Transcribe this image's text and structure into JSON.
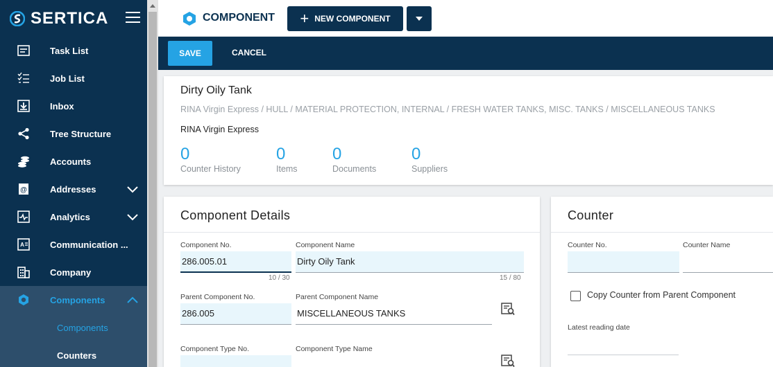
{
  "brand": {
    "name": "SERTICA"
  },
  "sidebar": {
    "items": [
      {
        "label": "Task List",
        "icon": "task-list-icon"
      },
      {
        "label": "Job List",
        "icon": "job-list-icon"
      },
      {
        "label": "Inbox",
        "icon": "inbox-icon"
      },
      {
        "label": "Tree Structure",
        "icon": "tree-structure-icon"
      },
      {
        "label": "Accounts",
        "icon": "accounts-icon"
      },
      {
        "label": "Addresses",
        "icon": "addresses-icon"
      },
      {
        "label": "Analytics",
        "icon": "analytics-icon"
      },
      {
        "label": "Communication ...",
        "icon": "communication-icon"
      },
      {
        "label": "Company",
        "icon": "company-icon"
      },
      {
        "label": "Components",
        "icon": "components-icon"
      }
    ],
    "sub_items": [
      {
        "label": "Components"
      },
      {
        "label": "Counters"
      }
    ]
  },
  "topbar": {
    "title": "COMPONENT",
    "new_button": "NEW COMPONENT"
  },
  "actions": {
    "save": "SAVE",
    "cancel": "CANCEL"
  },
  "header": {
    "title": "Dirty Oily Tank",
    "breadcrumb": "RINA Virgin Express / HULL / MATERIAL PROTECTION, INTERNAL / FRESH WATER TANKS, MISC. TANKS / MISCELLANEOUS TANKS",
    "vessel": "RINA Virgin Express",
    "stats": [
      {
        "value": "0",
        "label": "Counter History"
      },
      {
        "value": "0",
        "label": "Items"
      },
      {
        "value": "0",
        "label": "Documents"
      },
      {
        "value": "0",
        "label": "Suppliers"
      }
    ]
  },
  "details": {
    "title": "Component Details",
    "component_no_label": "Component No.",
    "component_no_value": "286.005.01",
    "component_no_count": "10 / 30",
    "component_name_label": "Component Name",
    "component_name_value": "Dirty Oily Tank",
    "component_name_count": "15 / 80",
    "parent_no_label": "Parent Component No.",
    "parent_no_value": "286.005",
    "parent_name_label": "Parent Component Name",
    "parent_name_value": "MISCELLANEOUS TANKS",
    "type_no_label": "Component Type No.",
    "type_no_value": "",
    "type_name_label": "Component Type Name",
    "type_name_value": ""
  },
  "counter": {
    "title": "Counter",
    "counter_no_label": "Counter No.",
    "counter_no_value": "",
    "counter_name_label": "Counter Name",
    "counter_name_value": "",
    "copy_label": "Copy Counter from Parent Component",
    "latest_reading_label": "Latest reading date",
    "latest_reading_value": ""
  },
  "colors": {
    "navy": "#0b3150",
    "accent": "#25a3e4",
    "input_bg": "#e8f6fc"
  }
}
